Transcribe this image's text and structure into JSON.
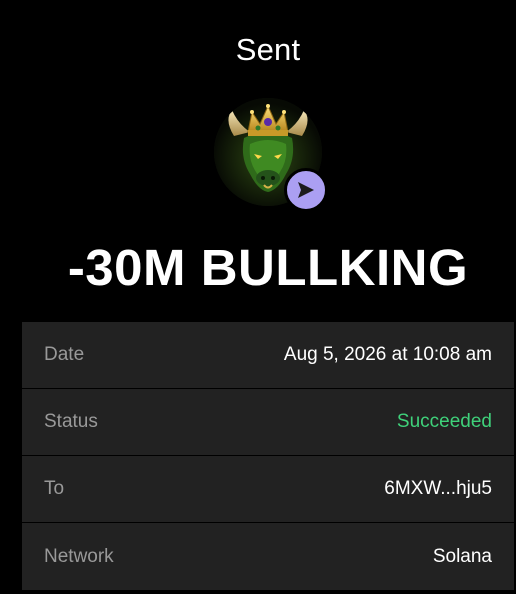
{
  "header": {
    "title": "Sent"
  },
  "token": {
    "icon": "bullking-token-icon",
    "badge_icon": "send-arrow-icon",
    "badge_color": "#ab9ff2"
  },
  "amount": "-30M BULLKING",
  "details": [
    {
      "label": "Date",
      "value": "Aug 5, 2026 at 10:08 am"
    },
    {
      "label": "Status",
      "value": "Succeeded",
      "color": "#3fd17a"
    },
    {
      "label": "To",
      "value": "6MXW...hju5"
    },
    {
      "label": "Network",
      "value": "Solana"
    }
  ]
}
